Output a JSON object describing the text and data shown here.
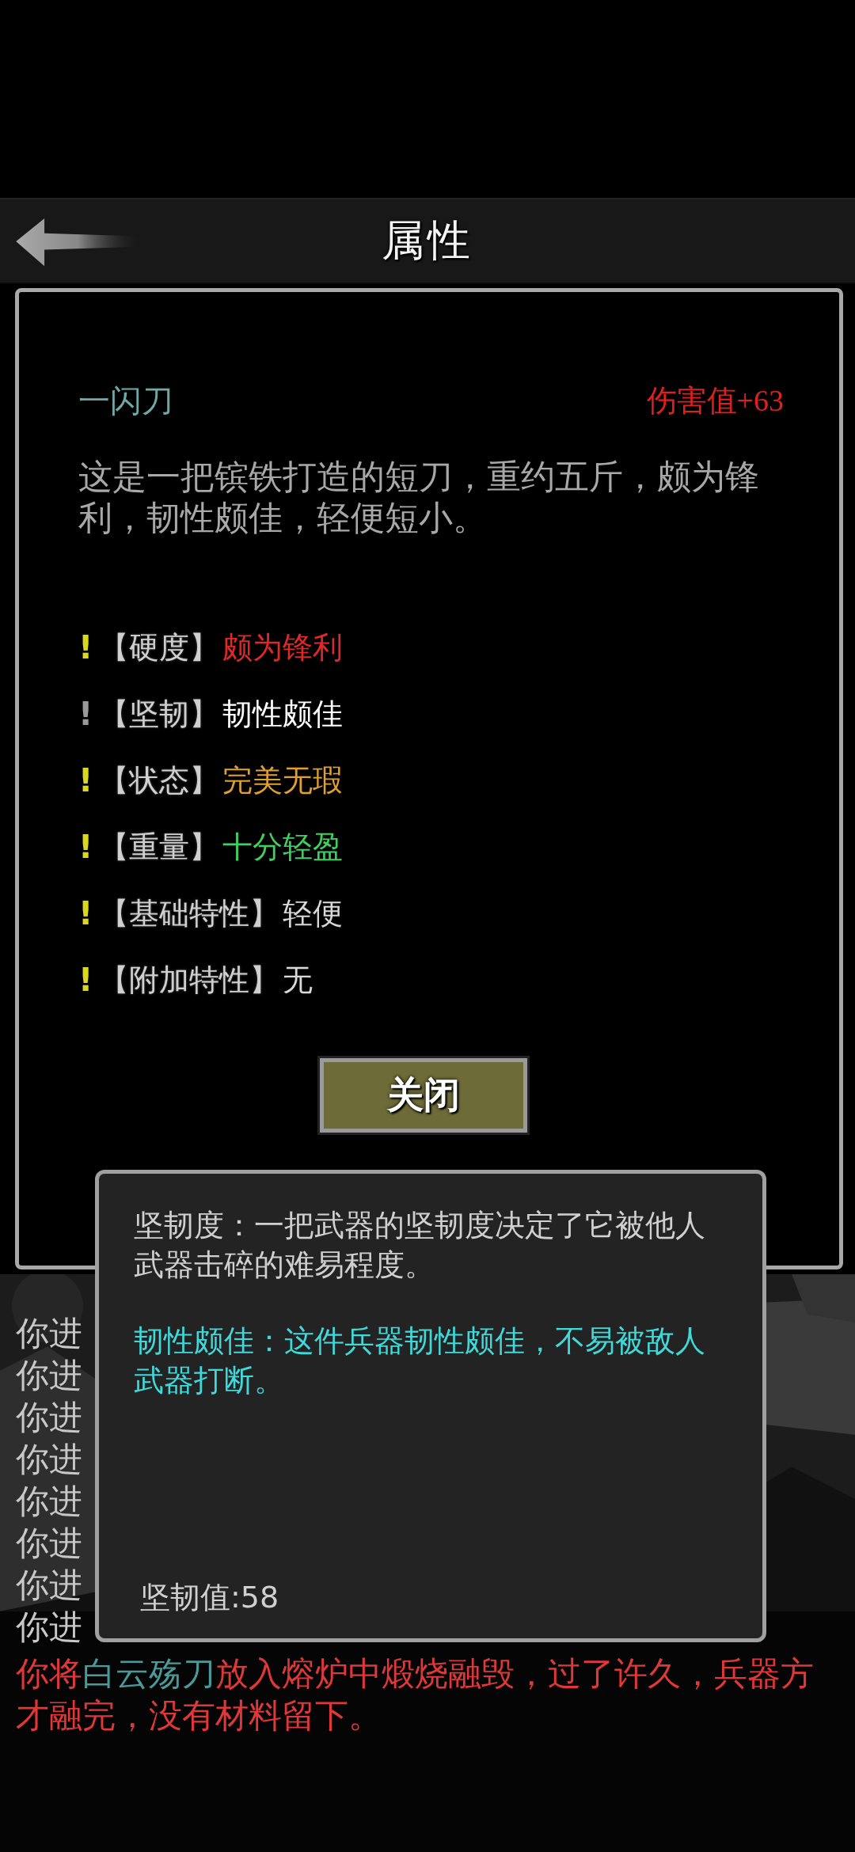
{
  "header": {
    "title": "属性"
  },
  "item": {
    "name": "一闪刀",
    "damage": "伤害值+63",
    "description": "这是一把镔铁打造的短刀，重约五斤，颇为锋利，韧性颇佳，轻便短小。"
  },
  "attributes": [
    {
      "marker": "!",
      "highlighted": true,
      "label": "【硬度】",
      "value": "颇为锋利",
      "color": "#e02828"
    },
    {
      "marker": "!",
      "highlighted": false,
      "label": "【坚韧】",
      "value": "韧性颇佳",
      "color": "#ffffff"
    },
    {
      "marker": "!",
      "highlighted": true,
      "label": "【状态】",
      "value": "完美无瑕",
      "color": "#e0a030"
    },
    {
      "marker": "!",
      "highlighted": true,
      "label": "【重量】",
      "value": "十分轻盈",
      "color": "#40d060"
    },
    {
      "marker": "!",
      "highlighted": true,
      "label": "【基础特性】",
      "value": "轻便",
      "color": "#d8d8d8"
    },
    {
      "marker": "!",
      "highlighted": true,
      "label": "【附加特性】",
      "value": "无",
      "color": "#d8d8d8"
    }
  ],
  "close_button": {
    "label": "关闭"
  },
  "log": [
    {
      "segments": [
        {
          "text": "你进",
          "color": "#c8c8c8"
        }
      ]
    },
    {
      "segments": [
        {
          "text": "你进",
          "color": "#c8c8c8"
        }
      ]
    },
    {
      "segments": [
        {
          "text": "你进",
          "color": "#c8c8c8"
        }
      ]
    },
    {
      "segments": [
        {
          "text": "你进",
          "color": "#c8c8c8"
        }
      ]
    },
    {
      "segments": [
        {
          "text": "你进",
          "color": "#c8c8c8"
        }
      ]
    },
    {
      "segments": [
        {
          "text": "你进",
          "color": "#c8c8c8"
        }
      ]
    },
    {
      "segments": [
        {
          "text": "你进",
          "color": "#c8c8c8"
        }
      ]
    },
    {
      "segments": [
        {
          "text": "你进",
          "color": "#c8c8c8"
        }
      ]
    },
    {
      "segments": [
        {
          "text": "你将",
          "color": "#e03838"
        },
        {
          "text": "白云殇刀",
          "color": "#4a9a9a"
        },
        {
          "text": "放入熔炉中煅烧融毁，过了许久，兵器方才融完，没有材料留下。",
          "color": "#e03838"
        }
      ]
    }
  ],
  "tooltip": {
    "definition": "坚韧度：一把武器的坚韧度决定了它被他人武器击碎的难易程度。",
    "detail": "韧性颇佳：这件兵器韧性颇佳，不易被敌人武器打断。",
    "value": "坚韧值:58"
  }
}
